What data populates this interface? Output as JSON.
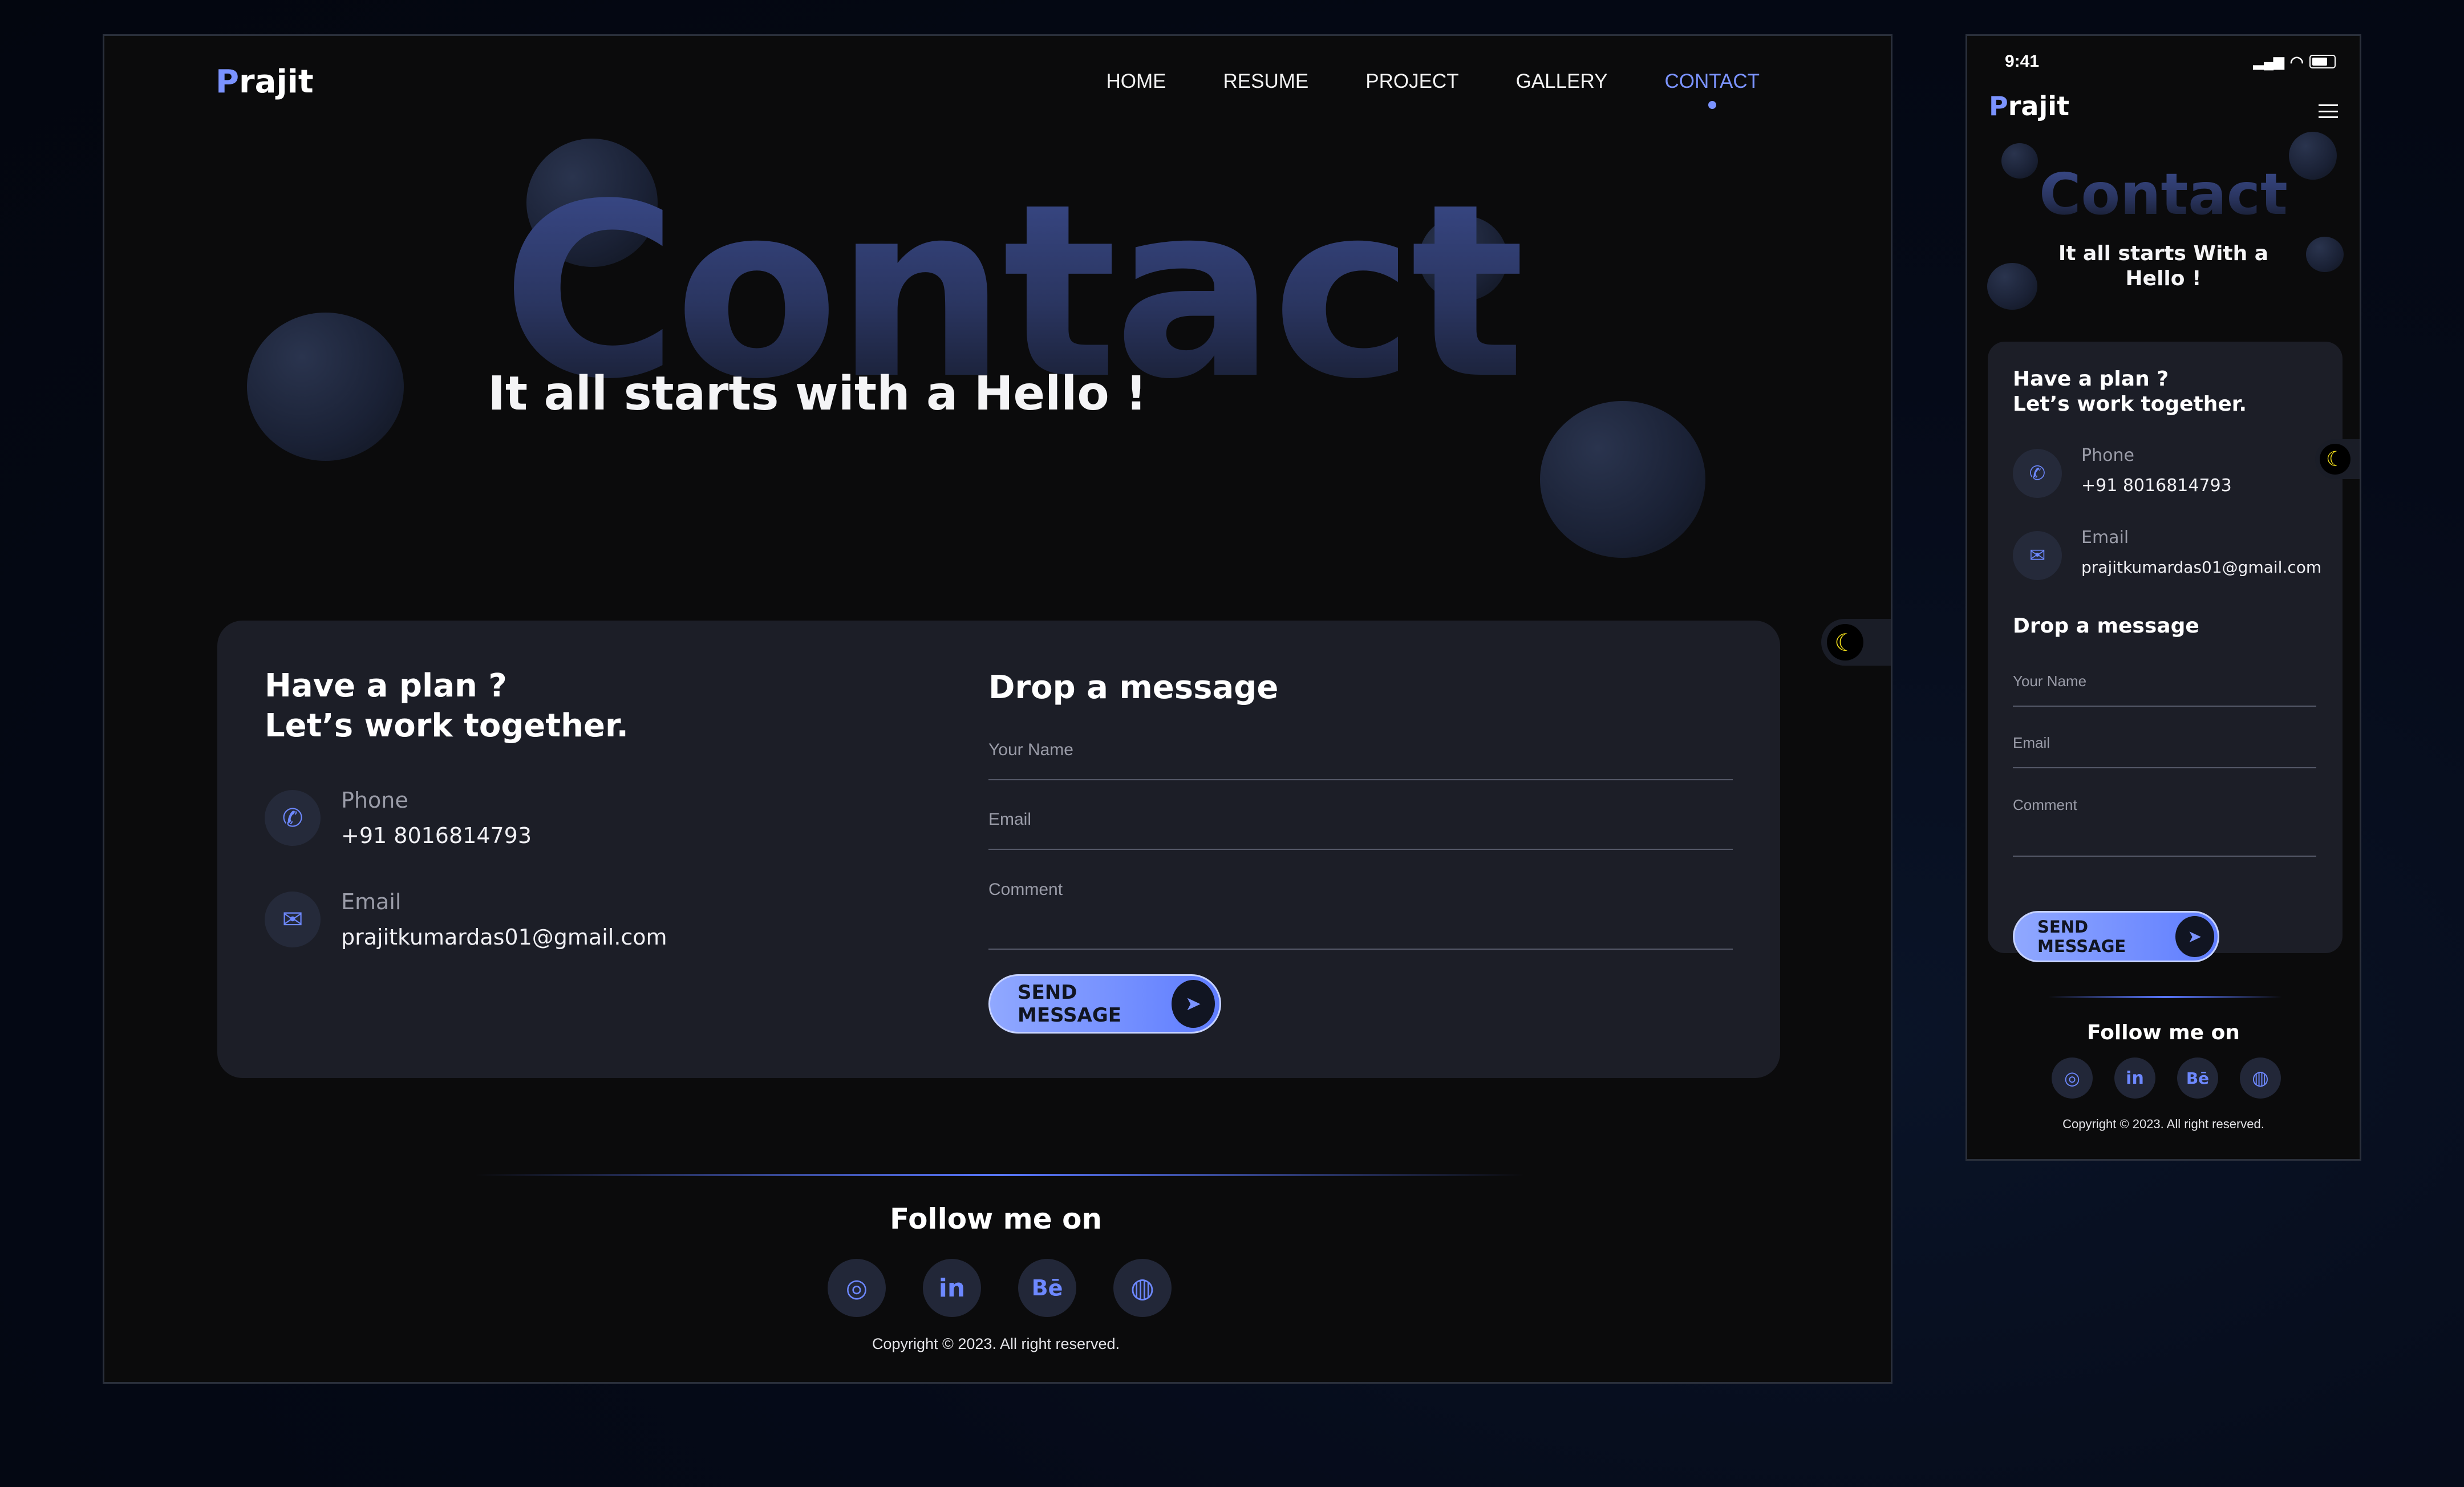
{
  "brand": {
    "logo_mark": "P",
    "logo_text": "rajit"
  },
  "nav": {
    "items": [
      {
        "label": "HOME",
        "active": false
      },
      {
        "label": "RESUME",
        "active": false
      },
      {
        "label": "PROJECT",
        "active": false
      },
      {
        "label": "GALLERY",
        "active": false
      },
      {
        "label": "CONTACT",
        "active": true
      }
    ]
  },
  "hero": {
    "title": "Contact",
    "subtitle_desktop": "It all starts with a Hello !",
    "subtitle_mobile": "It all starts With a Hello !"
  },
  "contact": {
    "plan_line1": "Have a plan ?",
    "plan_line2": "Let’s work together.",
    "phone": {
      "label": "Phone",
      "value": "+91 8016814793",
      "icon": "phone-icon"
    },
    "email": {
      "label": "Email",
      "value": "prajitkumardas01@gmail.com",
      "icon": "envelope-icon"
    }
  },
  "form": {
    "title": "Drop a message",
    "name_placeholder": "Your Name",
    "email_placeholder": "Email",
    "comment_placeholder": "Comment",
    "submit_label": "SEND MESSAGE",
    "submit_icon": "paper-plane-icon"
  },
  "footer": {
    "follow_label": "Follow me on",
    "socials": [
      {
        "name": "instagram-icon",
        "glyph": "◎"
      },
      {
        "name": "linkedin-icon",
        "glyph": "in"
      },
      {
        "name": "behance-icon",
        "glyph": "Bē"
      },
      {
        "name": "dribbble-icon",
        "glyph": "◍"
      }
    ],
    "copyright": "Copyright © 2023. All right reserved."
  },
  "mobile": {
    "status_time": "9:41"
  },
  "theme_toggle": {
    "icon": "moon-icon",
    "glyph": "☾"
  },
  "colors": {
    "accent": "#7b93ff",
    "background": "#0b0b0c",
    "card": "#1c1e27",
    "moon": "#f5e11a"
  }
}
